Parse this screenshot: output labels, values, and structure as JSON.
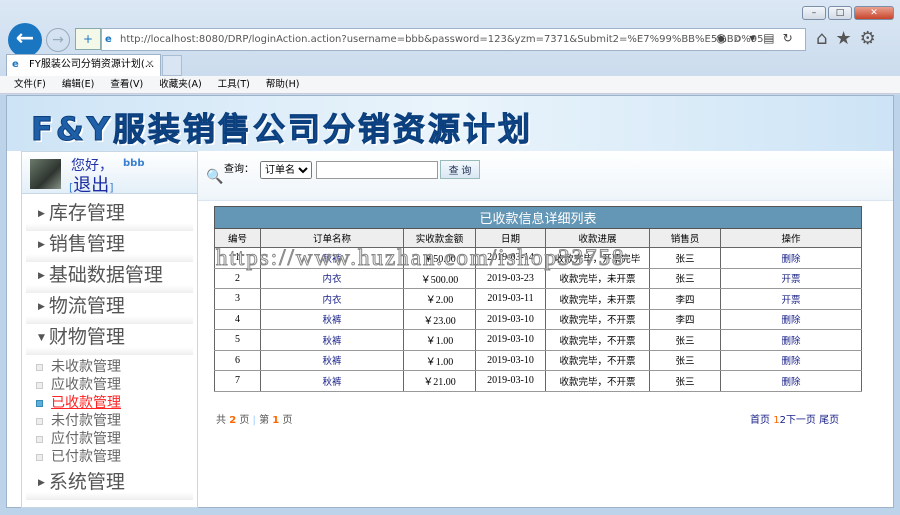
{
  "browser": {
    "url": "http://localhost:8080/DRP/loginAction.action?username=bbb&password=123&yzm=7371&Submit2=%E7%99%BB%E5%BD%95",
    "tab_title": "FY服装公司分销资源计划(...",
    "menu": [
      "文件(F)",
      "编辑(E)",
      "查看(V)",
      "收藏夹(A)",
      "工具(T)",
      "帮助(H)"
    ]
  },
  "banner": {
    "title": "F&Y服装销售公司分销资源计划"
  },
  "user": {
    "greeting": "您好，",
    "name": "bbb",
    "logout": "退出",
    "bracket_l": "[",
    "bracket_r": "]"
  },
  "sidebar": {
    "items": [
      "库存管理",
      "销售管理",
      "基础数据管理",
      "物流管理"
    ],
    "open": "财物管理",
    "sub": [
      "未收款管理",
      "应收款管理",
      "已收款管理",
      "未付款管理",
      "应付款管理",
      "已付款管理"
    ],
    "active_index": 2,
    "last": "系统管理"
  },
  "search": {
    "label": "查询：",
    "select": "订单名",
    "value": "",
    "button": "查 询"
  },
  "table": {
    "caption": "已收款信息详细列表",
    "headers": [
      "编号",
      "订单名称",
      "实收款金额",
      "日期",
      "收款进展",
      "销售员",
      "操作"
    ],
    "rows": [
      [
        "1",
        "秋裤",
        "￥50.00",
        "2019-03-14",
        "收款完毕，开票完毕",
        "张三",
        "删除"
      ],
      [
        "2",
        "内衣",
        "￥500.00",
        "2019-03-23",
        "收款完毕，未开票",
        "张三",
        "开票"
      ],
      [
        "3",
        "内衣",
        "￥2.00",
        "2019-03-11",
        "收款完毕，未开票",
        "李四",
        "开票"
      ],
      [
        "4",
        "秋裤",
        "￥23.00",
        "2019-03-10",
        "收款完毕，不开票",
        "李四",
        "删除"
      ],
      [
        "5",
        "秋裤",
        "￥1.00",
        "2019-03-10",
        "收款完毕，不开票",
        "张三",
        "删除"
      ],
      [
        "6",
        "秋裤",
        "￥1.00",
        "2019-03-10",
        "收款完毕，不开票",
        "张三",
        "删除"
      ],
      [
        "7",
        "秋裤",
        "￥21.00",
        "2019-03-10",
        "收款完毕，不开票",
        "张三",
        "删除"
      ]
    ]
  },
  "pager": {
    "total_pre": "共",
    "total": "2",
    "total_post": "页",
    "sep": "|",
    "cur_pre": "第",
    "current": "1",
    "cur_post": "页",
    "first": "首页",
    "p1": "1",
    "p2": "2",
    "next": "下一页",
    "last": "尾页"
  },
  "watermark": "https://www.huzhan.com/ishop33758"
}
